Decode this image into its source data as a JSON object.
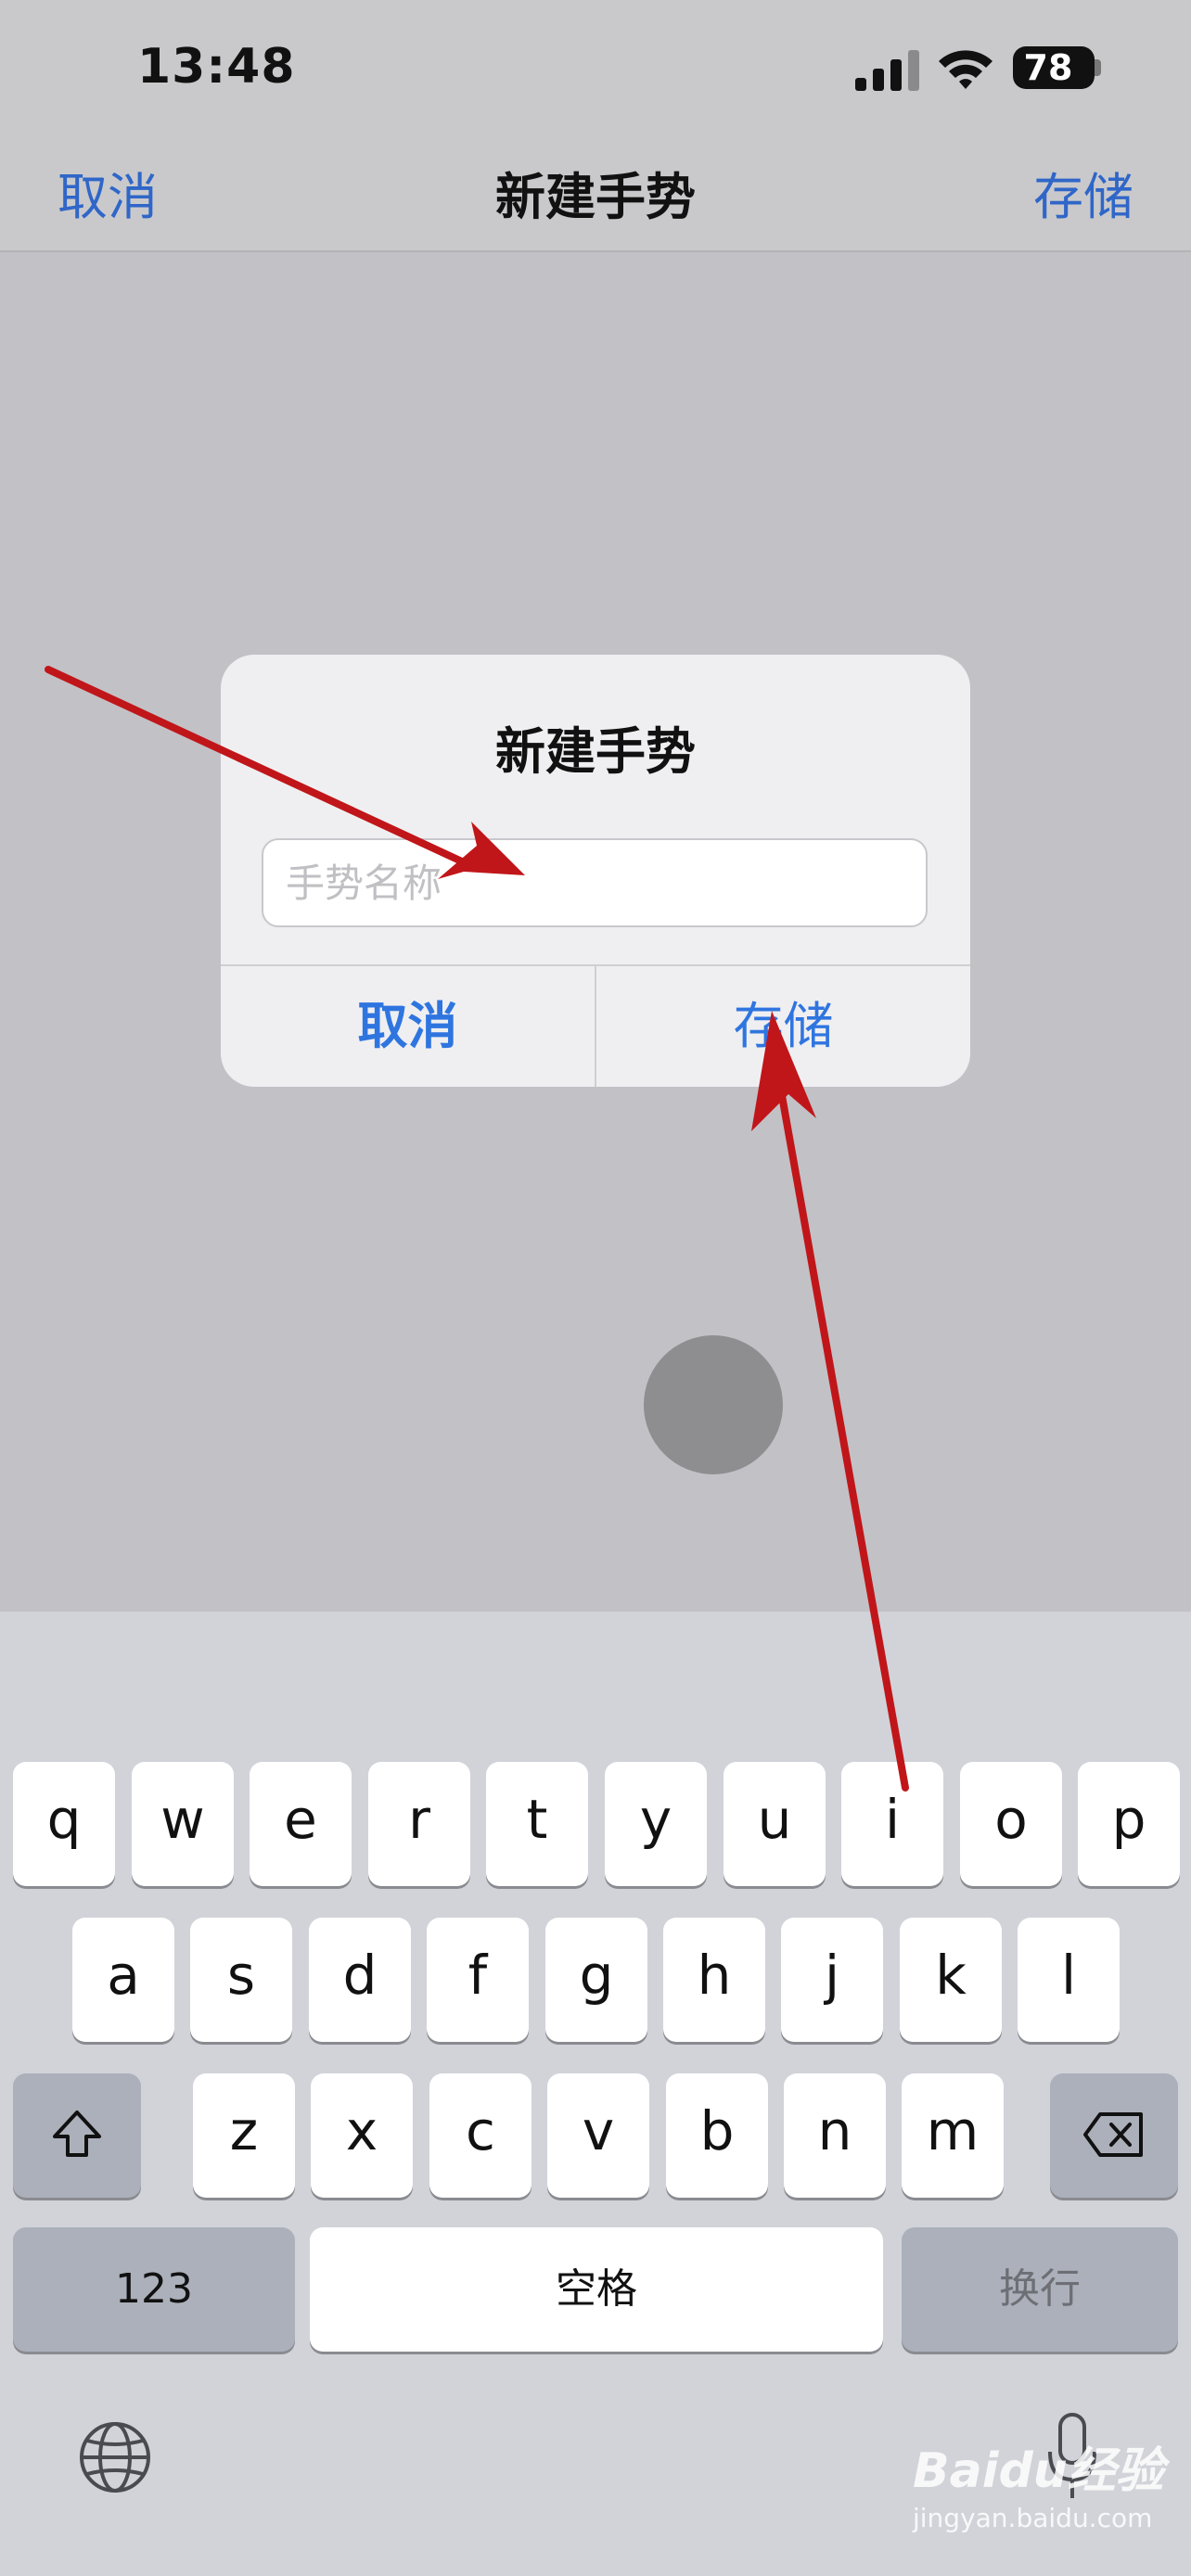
{
  "status_bar": {
    "time": "13:48",
    "battery": "78",
    "icons": [
      "cellular-signal-icon",
      "wifi-icon",
      "battery-icon"
    ]
  },
  "navbar": {
    "cancel_label": "取消",
    "title": "新建手势",
    "save_label": "存储"
  },
  "dialog": {
    "title": "新建手势",
    "input_placeholder": "手势名称",
    "input_value": "",
    "cancel_label": "取消",
    "save_label": "存储"
  },
  "keyboard": {
    "row1": [
      "q",
      "w",
      "e",
      "r",
      "t",
      "y",
      "u",
      "i",
      "o",
      "p"
    ],
    "row2": [
      "a",
      "s",
      "d",
      "f",
      "g",
      "h",
      "j",
      "k",
      "l"
    ],
    "row3": [
      "z",
      "x",
      "c",
      "v",
      "b",
      "n",
      "m"
    ],
    "numbers_label": "123",
    "space_label": "空格",
    "return_label": "换行",
    "icons": [
      "shift-icon",
      "delete-icon",
      "globe-icon",
      "microphone-icon"
    ]
  },
  "watermark": {
    "logo": "Baidu经验",
    "url": "jingyan.baidu.com"
  },
  "colors": {
    "link_blue": "#2f66c8",
    "dialog_blue": "#2f75e0",
    "annotation_red": "#c0161a",
    "dimmed_background": "#c2c1c6",
    "keyboard_background": "#d1d3d9"
  }
}
